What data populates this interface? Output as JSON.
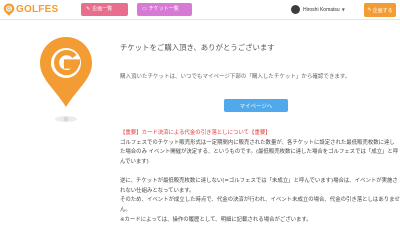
{
  "header": {
    "logo_text": "GOLFES",
    "nav": [
      {
        "label": "企画一覧",
        "icon": "pen-icon"
      },
      {
        "label": "チケット一覧",
        "icon": "ticket-icon"
      }
    ],
    "user_name": "Hiroshi Komatsu",
    "register_label": "企画する",
    "colors": {
      "brand": "#f39c34",
      "nav1": "#e76e8c",
      "nav2": "#d67ad6"
    }
  },
  "main": {
    "heading": "チケットをご購入頂き、ありがとうございます",
    "description": "購入頂いたチケットは、いつでもマイページ下部の「購入したチケット」から確認できます。",
    "mypage_button": "マイページへ",
    "button_color": "#4fa9ea"
  },
  "notice": {
    "title": "【重要】カード決済による代金の引き落としについて【重要】",
    "lines": [
      "ゴルフェスでのチケット販売形式は一定期間内に販売された数量が、各チケットに設定された最低販売枚数に達した場合のみ イベント開催が決定する、というものです。(最低販売枚数に達した場合をゴルフェスでは「成立」と呼んでいます)",
      "逆に、チケットが最低販売枚数に達しない(=ゴルフェスでは「未成立」と呼んでいます)場合は、イベントが実施されない仕組みとなっています。",
      "そのため、イベントが成立した時点で、代金の決済が行われ、イベント未成立の場合、代金の引き落としはありません。",
      "※カードによっては、操作の履歴として、明細に記載される場合がございます。"
    ]
  }
}
